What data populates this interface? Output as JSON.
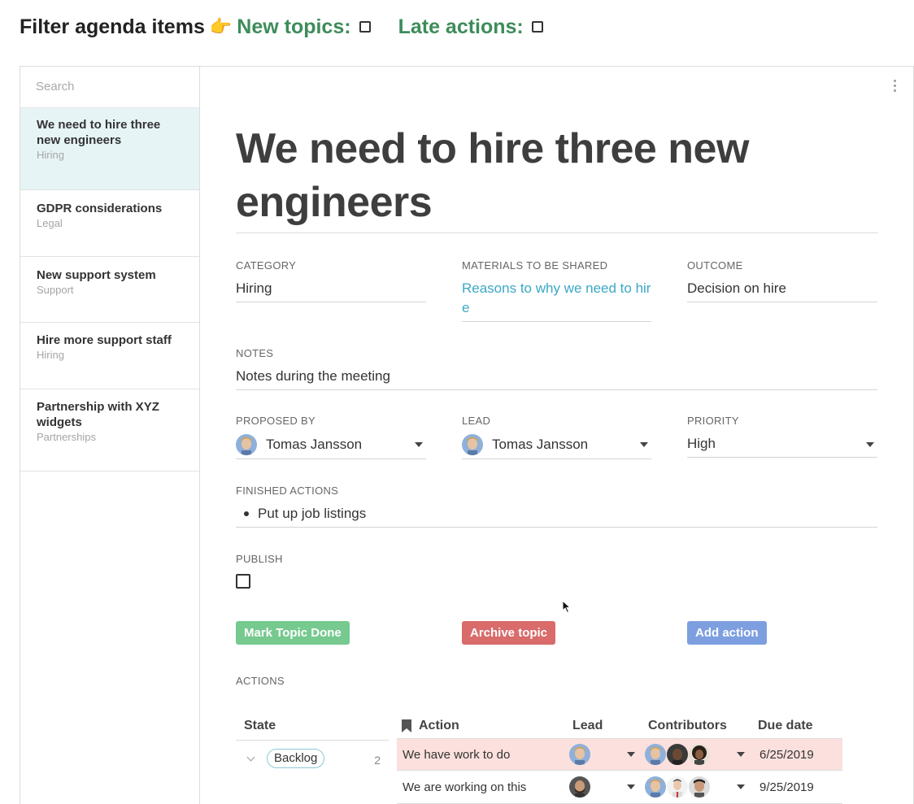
{
  "filter": {
    "title": "Filter agenda items",
    "pointer": "👉",
    "new_topics_label": "New topics:",
    "late_actions_label": "Late actions:"
  },
  "sidebar": {
    "search_placeholder": "Search",
    "topics": [
      {
        "title": "We need to hire three new engineers",
        "category": "Hiring"
      },
      {
        "title": "GDPR considerations",
        "category": "Legal"
      },
      {
        "title": "New support system",
        "category": "Support"
      },
      {
        "title": "Hire more support staff",
        "category": "Hiring"
      },
      {
        "title": "Partnership with XYZ widgets",
        "category": "Partnerships"
      }
    ]
  },
  "topic": {
    "title": "We need to hire three new engineers",
    "category_label": "CATEGORY",
    "category": "Hiring",
    "materials_label": "MATERIALS TO BE SHARED",
    "materials": "Reasons to why we need to hire",
    "outcome_label": "OUTCOME",
    "outcome": "Decision on hire",
    "notes_label": "NOTES",
    "notes": "Notes during the meeting",
    "proposed_by_label": "PROPOSED BY",
    "proposed_by": "Tomas Jansson",
    "lead_label": "LEAD",
    "lead": "Tomas Jansson",
    "priority_label": "PRIORITY",
    "priority": "High",
    "finished_actions_label": "FINISHED ACTIONS",
    "finished_actions": [
      "Put up job listings"
    ],
    "publish_label": "PUBLISH"
  },
  "buttons": {
    "mark_done": "Mark Topic Done",
    "archive": "Archive topic",
    "add_action": "Add action"
  },
  "colors": {
    "mark_done": "#76c98f",
    "archive": "#d96b6b",
    "add_action": "#7d9fe0",
    "filter_label": "#3d8c5a",
    "active_topic_bg": "#e7f4f6",
    "highlight_row": "#fbe0dd"
  },
  "actions": {
    "section_label": "ACTIONS",
    "headers": {
      "state": "State",
      "action": "Action",
      "lead": "Lead",
      "contributors": "Contributors",
      "due_date": "Due date"
    },
    "state_group": {
      "name": "Backlog",
      "count": "2"
    },
    "rows": [
      {
        "action": "We have work to do",
        "due": "6/25/2019"
      },
      {
        "action": "We are working on this",
        "due": "9/25/2019"
      }
    ]
  }
}
